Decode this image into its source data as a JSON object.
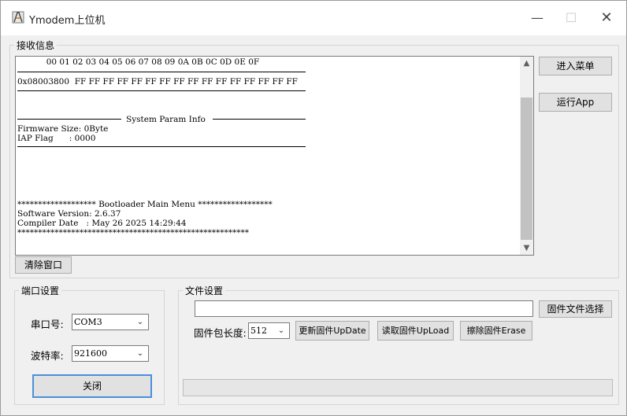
{
  "window": {
    "title": "Ymodem上位机",
    "minimize_glyph": "—",
    "maximize_glyph": "☐",
    "close_glyph": "✕"
  },
  "receive": {
    "legend": "接收信息",
    "lines": [
      "           00 01 02 03 04 05 06 07 08 09 0A 0B 0C 0D 0E 0F",
      "0x08003800  FF FF FF FF FF FF FF FF FF FF FF FF FF FF FF FF",
      "System Param Info",
      "Firmware Size: 0Byte",
      "IAP Flag      : 0000",
      "******************* Bootloader Main Menu ******************",
      "Software Version: 2.6.37",
      "Compiler Date   : May 26 2025 14:29:44",
      "********************************************************"
    ],
    "scroll_up": "▲",
    "scroll_down": "▼",
    "scroll_position": 0.25
  },
  "buttons": {
    "enter_menu": "进入菜单",
    "run_app": "运行App",
    "clear_window": "清除窗口",
    "close_port": "关闭",
    "select_firmware": "固件文件选择",
    "update": "更新固件UpDate",
    "upload": "读取固件UpLoad",
    "erase": "擦除固件Erase"
  },
  "port_settings": {
    "legend": "端口设置",
    "port_label": "串口号:",
    "port_value": "COM3",
    "baud_label": "波特率:",
    "baud_value": "921600"
  },
  "file_settings": {
    "legend": "文件设置",
    "file_path": "",
    "packet_length_label": "固件包长度:",
    "packet_length_value": "512",
    "progress": 0
  },
  "icons": {
    "app": "app-logo-icon",
    "chevron": "chevron-down-icon"
  },
  "colors": {
    "titlebar": "#ffffff",
    "window_bg": "#f0f0f0",
    "button_bg": "#e1e1e1",
    "default_button_border": "#4a90d9",
    "scroll_thumb": "#c2c2c2"
  }
}
